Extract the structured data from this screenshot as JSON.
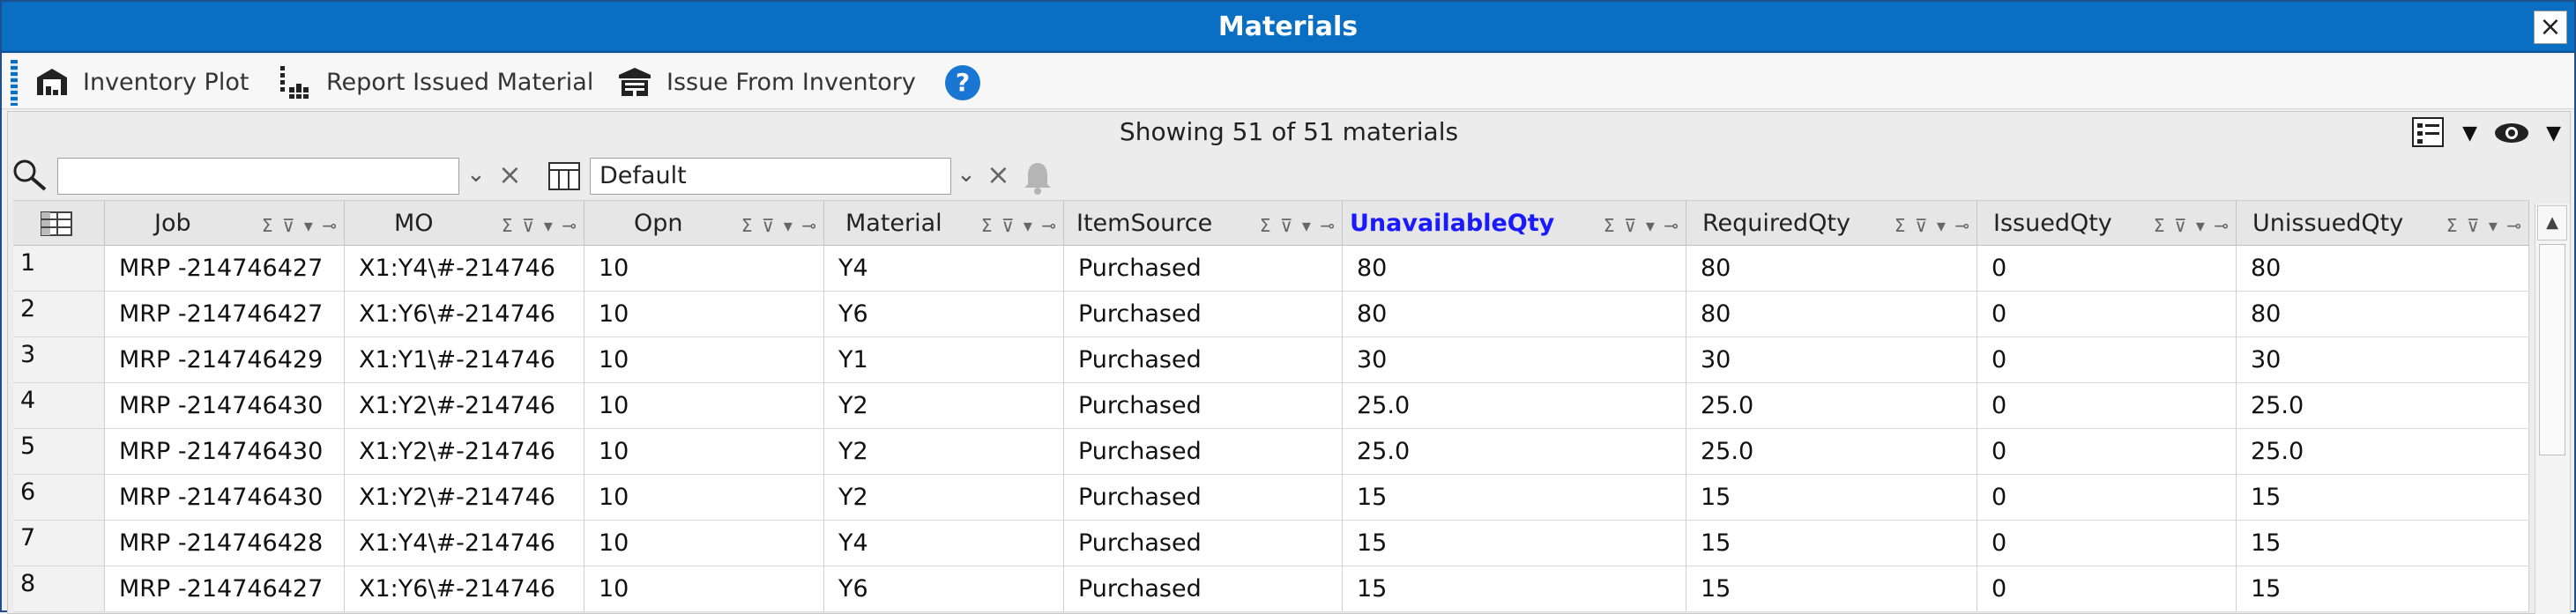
{
  "window": {
    "title": "Materials",
    "close_label": "×"
  },
  "toolbar": {
    "items": [
      {
        "label": "Inventory Plot",
        "icon": "warehouse-icon"
      },
      {
        "label": "Report Issued Material",
        "icon": "report-issued-icon"
      },
      {
        "label": "Issue From Inventory",
        "icon": "issue-inventory-icon"
      }
    ],
    "help_label": "?"
  },
  "grid": {
    "status_text": "Showing 51 of 51 materials",
    "search": {
      "value": "",
      "placeholder": ""
    },
    "view": {
      "selected": "Default"
    },
    "columns": [
      {
        "label": "Job"
      },
      {
        "label": "MO"
      },
      {
        "label": "Opn"
      },
      {
        "label": "Material"
      },
      {
        "label": "ItemSource"
      },
      {
        "label": "UnavailableQty",
        "sorted": true
      },
      {
        "label": "RequiredQty"
      },
      {
        "label": "IssuedQty"
      },
      {
        "label": "UnissuedQty"
      }
    ],
    "header_tools": "Σ ⊽ ▾ ⊸",
    "rows": [
      {
        "num": "1",
        "cells": [
          "MRP -214746427",
          "X1:Y4\\#-214746",
          "10",
          "Y4",
          "Purchased",
          "80",
          "80",
          "0",
          "80"
        ]
      },
      {
        "num": "2",
        "cells": [
          "MRP -214746427",
          "X1:Y6\\#-214746",
          "10",
          "Y6",
          "Purchased",
          "80",
          "80",
          "0",
          "80"
        ]
      },
      {
        "num": "3",
        "cells": [
          "MRP -214746429",
          "X1:Y1\\#-214746",
          "10",
          "Y1",
          "Purchased",
          "30",
          "30",
          "0",
          "30"
        ]
      },
      {
        "num": "4",
        "cells": [
          "MRP -214746430",
          "X1:Y2\\#-214746",
          "10",
          "Y2",
          "Purchased",
          "25.0",
          "25.0",
          "0",
          "25.0"
        ]
      },
      {
        "num": "5",
        "cells": [
          "MRP -214746430",
          "X1:Y2\\#-214746",
          "10",
          "Y2",
          "Purchased",
          "25.0",
          "25.0",
          "0",
          "25.0"
        ]
      },
      {
        "num": "6",
        "cells": [
          "MRP -214746430",
          "X1:Y2\\#-214746",
          "10",
          "Y2",
          "Purchased",
          "15",
          "15",
          "0",
          "15"
        ]
      },
      {
        "num": "7",
        "cells": [
          "MRP -214746428",
          "X1:Y4\\#-214746",
          "10",
          "Y4",
          "Purchased",
          "15",
          "15",
          "0",
          "15"
        ]
      },
      {
        "num": "8",
        "cells": [
          "MRP -214746427",
          "X1:Y6\\#-214746",
          "10",
          "Y6",
          "Purchased",
          "15",
          "15",
          "0",
          "15"
        ]
      }
    ]
  },
  "colors": {
    "titlebar": "#0a6fc2",
    "sorted_header": "#1a1aff",
    "help": "#1976d2"
  }
}
